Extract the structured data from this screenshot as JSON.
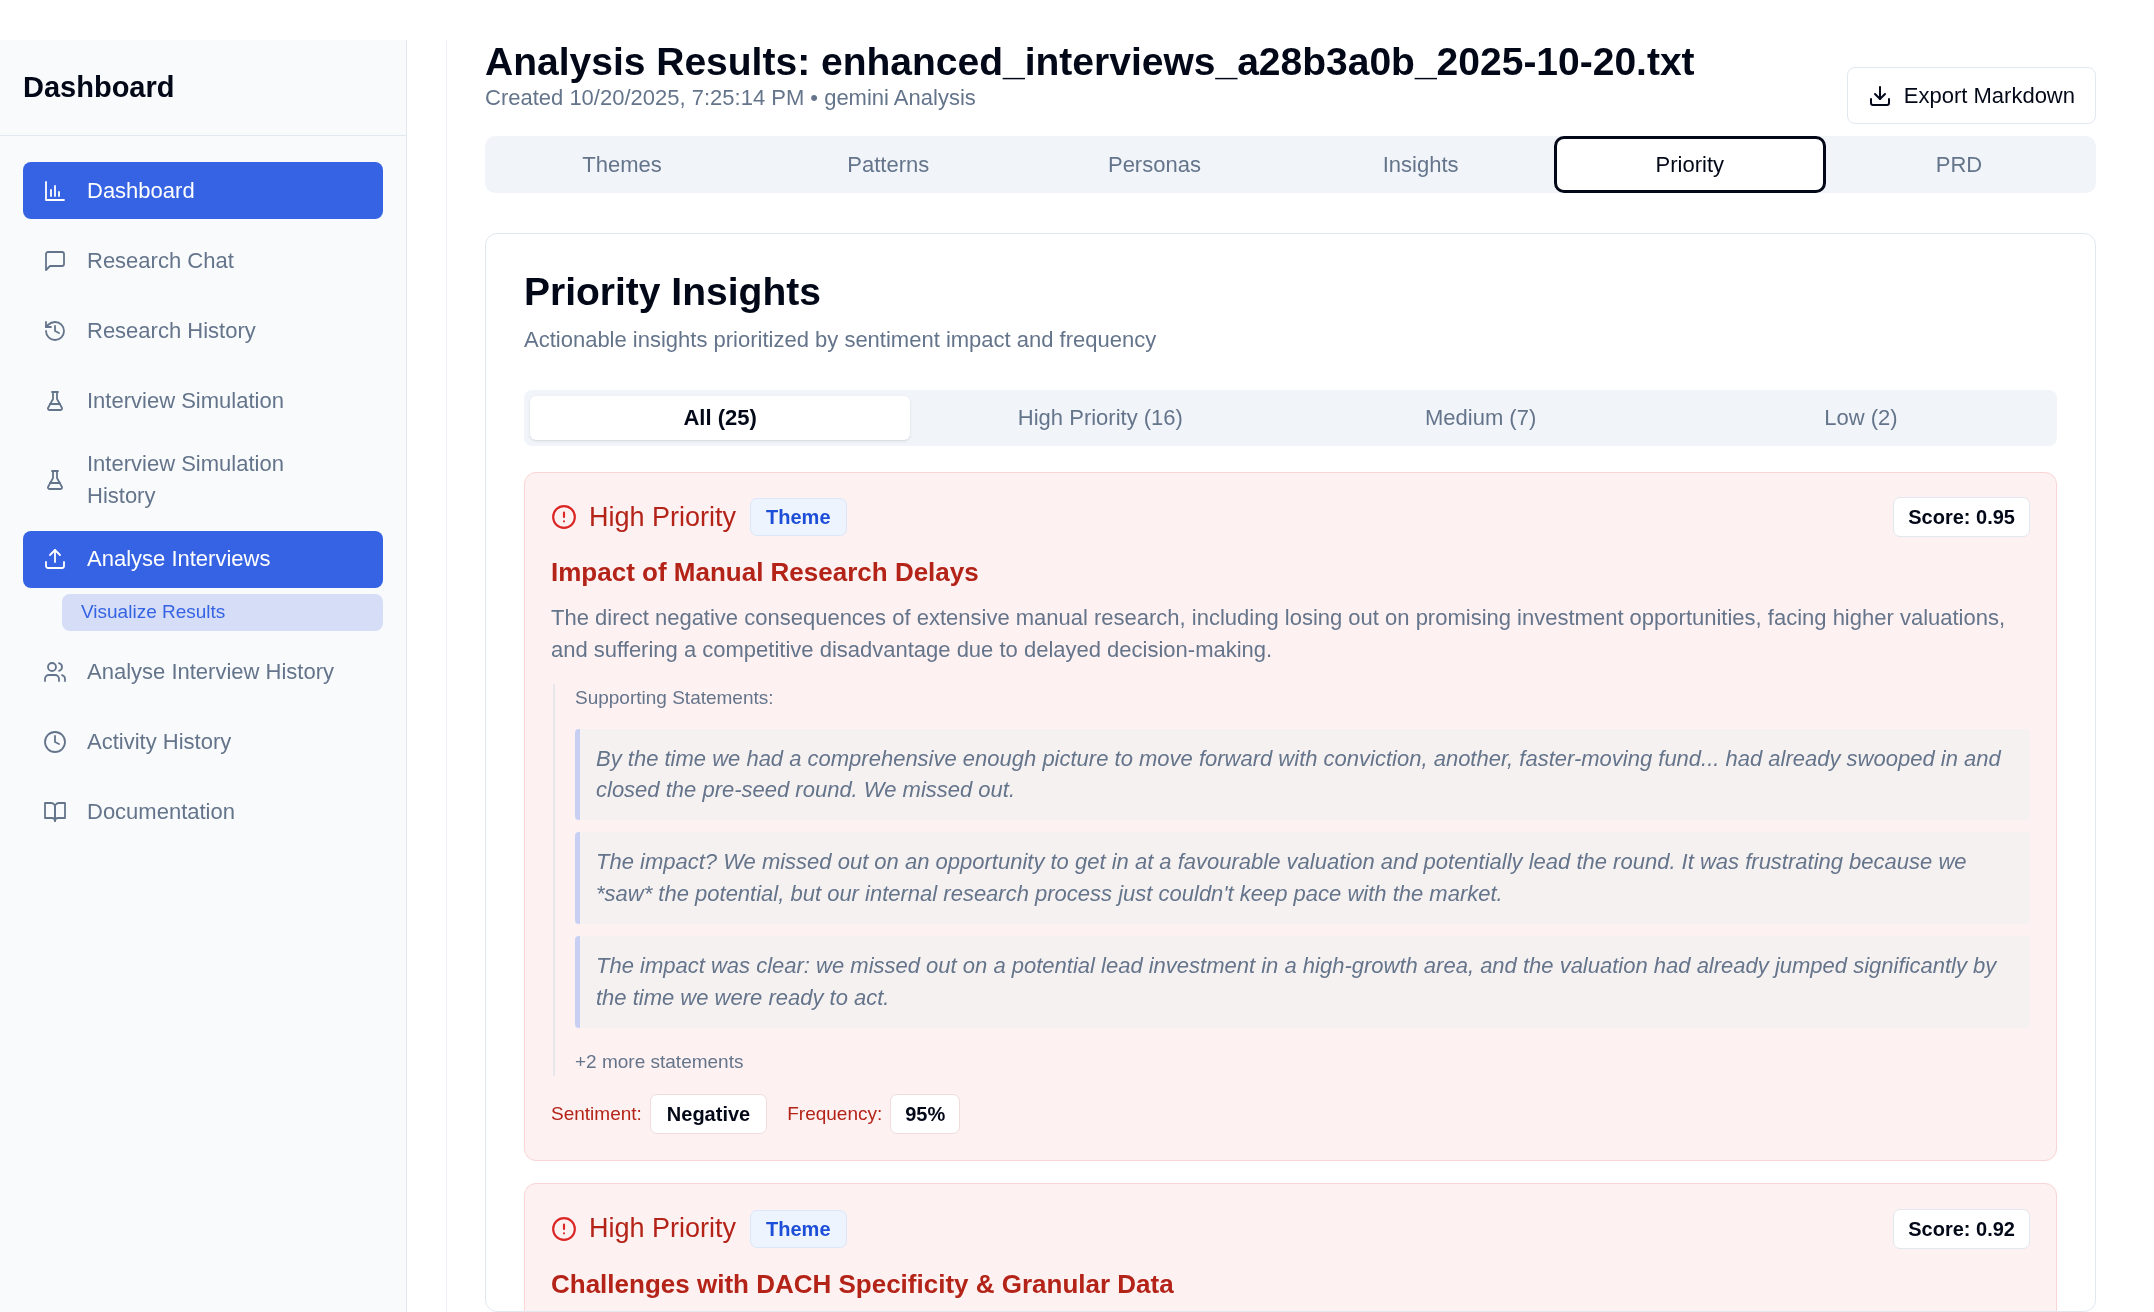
{
  "sidebar": {
    "title": "Dashboard",
    "items": [
      {
        "label": "Dashboard",
        "selected": true
      },
      {
        "label": "Research Chat",
        "selected": false
      },
      {
        "label": "Research History",
        "selected": false
      },
      {
        "label": "Interview Simulation",
        "selected": false
      },
      {
        "label": "Interview Simulation History",
        "selected": false
      },
      {
        "label": "Analyse Interviews",
        "selected": true,
        "children": [
          {
            "label": "Visualize Results",
            "selected": true
          }
        ]
      },
      {
        "label": "Analyse Interview History",
        "selected": false
      },
      {
        "label": "Activity History",
        "selected": false
      },
      {
        "label": "Documentation",
        "selected": false
      }
    ]
  },
  "header": {
    "title": "Analysis Results: enhanced_interviews_a28b3a0b_2025-10-20.txt",
    "subtitle": "Created 10/20/2025, 7:25:14 PM • gemini Analysis",
    "export_button": "Export Markdown"
  },
  "tabs": [
    {
      "label": "Themes",
      "selected": false
    },
    {
      "label": "Patterns",
      "selected": false
    },
    {
      "label": "Personas",
      "selected": false
    },
    {
      "label": "Insights",
      "selected": false
    },
    {
      "label": "Priority",
      "selected": true
    },
    {
      "label": "PRD",
      "selected": false
    }
  ],
  "panel": {
    "title": "Priority Insights",
    "subtitle": "Actionable insights prioritized by sentiment impact and frequency",
    "filters": [
      {
        "label": "All (25)",
        "selected": true
      },
      {
        "label": "High Priority (16)",
        "selected": false
      },
      {
        "label": "Medium (7)",
        "selected": false
      },
      {
        "label": "Low (2)",
        "selected": false
      }
    ],
    "cards": [
      {
        "kind": "high",
        "priority_label": "High Priority",
        "tag": "Theme",
        "score": "Score: 0.95",
        "title": "Impact of Manual Research Delays",
        "description": "The direct negative consequences of extensive manual research, including losing out on promising investment opportunities, facing higher valuations, and suffering a competitive disadvantage due to delayed decision-making.",
        "statements_label": "Supporting Statements:",
        "statements": [
          "By the time we had a comprehensive enough picture to move forward with conviction, another, faster-moving fund... had already swooped in and closed the pre-seed round. We missed out.",
          "The impact? We missed out on an opportunity to get in at a favourable valuation and potentially lead the round. It was frustrating because we *saw* the potential, but our internal research process just couldn't keep pace with the market.",
          "The impact was clear: we missed out on a potential lead investment in a high-growth area, and the valuation had already jumped significantly by the time we were ready to act."
        ],
        "more": "+2 more statements",
        "sentiment_label": "Sentiment:",
        "sentiment": "Negative",
        "frequency_label": "Frequency:",
        "frequency": "95%"
      },
      {
        "kind": "high",
        "priority_label": "High Priority",
        "tag": "Theme",
        "score": "Score: 0.92",
        "title": "Challenges with DACH Specificity & Granular Data"
      }
    ]
  }
}
